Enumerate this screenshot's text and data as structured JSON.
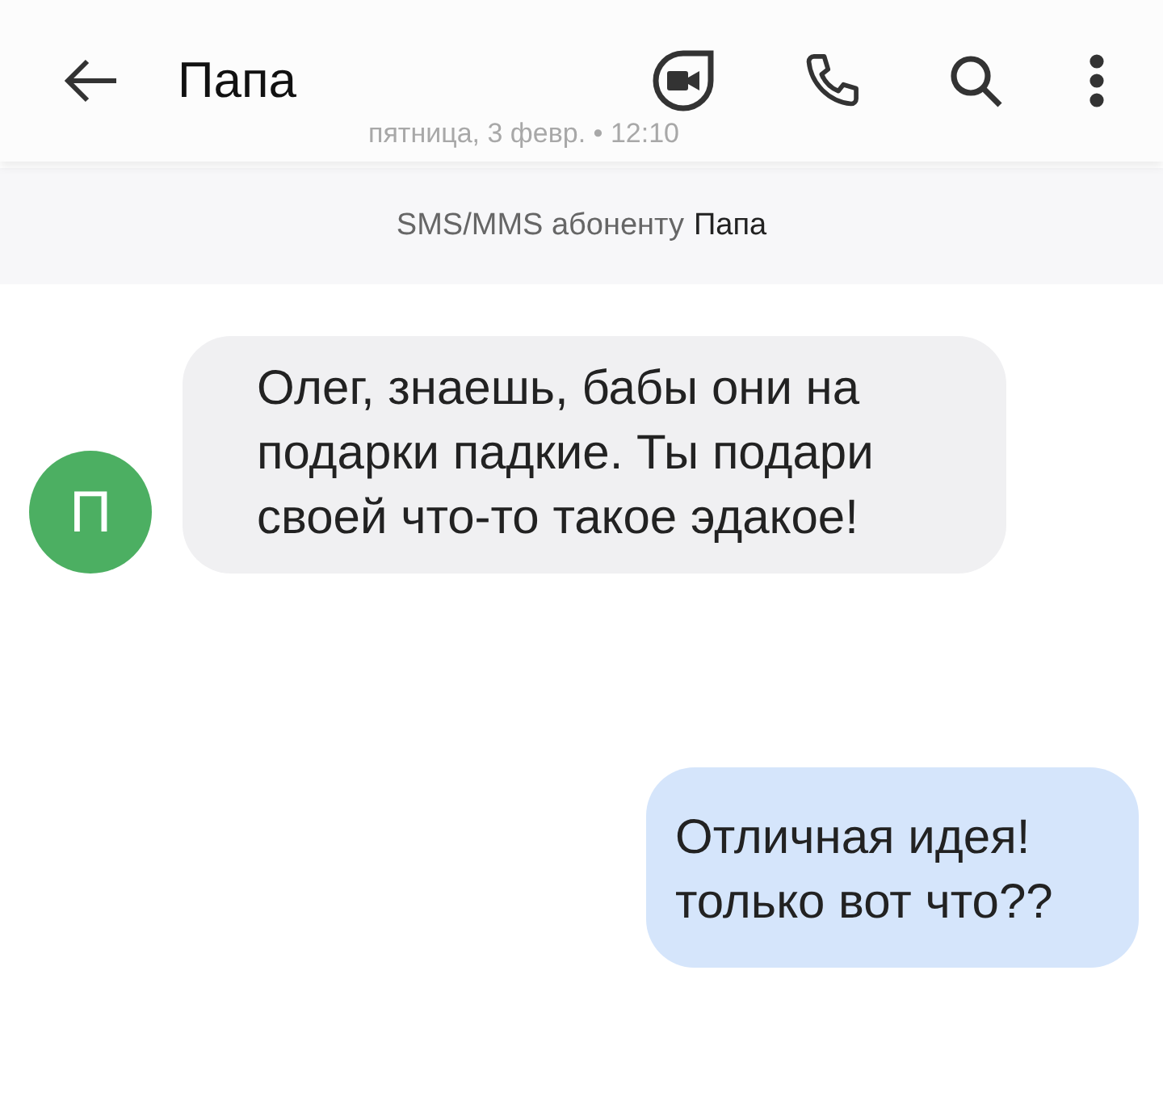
{
  "header": {
    "title": "Папа",
    "timestamp": "пятница, 3 февр. • 12:10"
  },
  "banner": {
    "prefix": "SMS/MMS абоненту",
    "name": "Папа"
  },
  "messages": [
    {
      "kind": "incoming",
      "avatar": "П",
      "color": "#4caf62",
      "text": "Олег, знаешь, бабы они на подарки падкие. Ты подари своей что-то такое эдакое!"
    },
    {
      "kind": "outgoing",
      "text": "Отличная идея! только вот что??"
    }
  ]
}
